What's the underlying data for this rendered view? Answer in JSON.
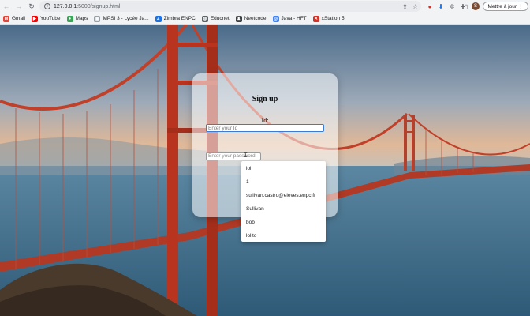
{
  "browser": {
    "url_host": "127.0.0.1",
    "url_rest": ":5000/signup.html",
    "update_label": "Mettre à jour",
    "profile_initial": "S"
  },
  "bookmarks": [
    {
      "label": "Gmail",
      "icon": "gmail-icon",
      "color": "#ea4335",
      "glyph": "M"
    },
    {
      "label": "YouTube",
      "icon": "youtube-icon",
      "color": "#ff0000",
      "glyph": "▶"
    },
    {
      "label": "Maps",
      "icon": "maps-icon",
      "color": "#34a853",
      "glyph": "●"
    },
    {
      "label": "MPSI 3 - Lycée Ja...",
      "icon": "mpsi-icon",
      "color": "#9aa0a6",
      "glyph": "▦"
    },
    {
      "label": "Zimbra ENPC",
      "icon": "zimbra-icon",
      "color": "#1a73e8",
      "glyph": "Z"
    },
    {
      "label": "Educnet",
      "icon": "educnet-icon",
      "color": "#5f6368",
      "glyph": "◍"
    },
    {
      "label": "Neetcode",
      "icon": "neetcode-icon",
      "color": "#3c4043",
      "glyph": "♜"
    },
    {
      "label": "Java - HFT",
      "icon": "java-icon",
      "color": "#4285f4",
      "glyph": "◎"
    },
    {
      "label": "xStation 5",
      "icon": "xstation-icon",
      "color": "#d93025",
      "glyph": "✕"
    }
  ],
  "form": {
    "title": "Sign up",
    "id_label": "Id:",
    "id_placeholder": "Enter your Id",
    "password_placeholder": "Enter your password"
  },
  "autocomplete": [
    "lol",
    "1",
    "sullivan.castro@eleves.enpc.fr",
    "Sullivan",
    "bob",
    "lolito"
  ]
}
